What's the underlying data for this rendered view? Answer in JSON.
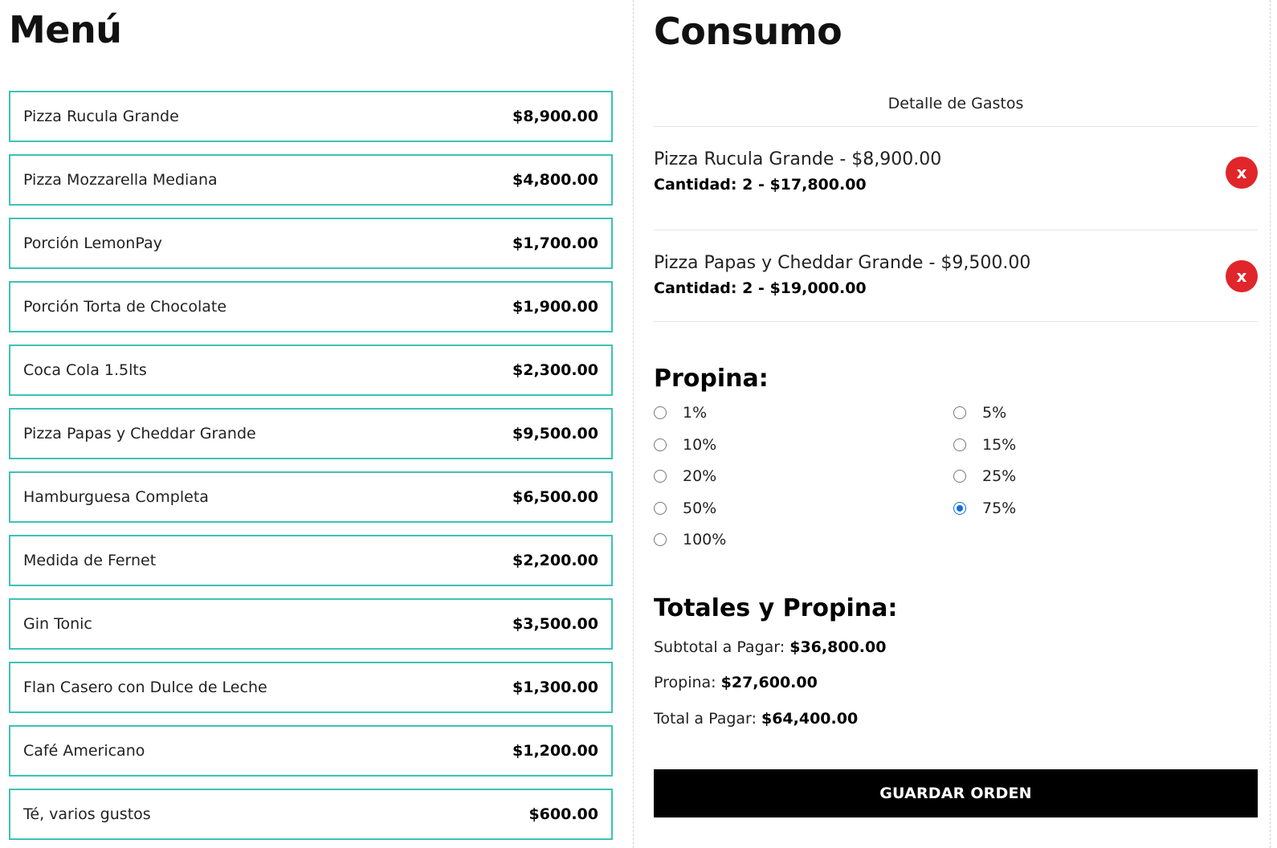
{
  "menu": {
    "title": "Menú",
    "items": [
      {
        "name": "Pizza Rucula Grande",
        "price": "$8,900.00"
      },
      {
        "name": "Pizza Mozzarella Mediana",
        "price": "$4,800.00"
      },
      {
        "name": "Porción LemonPay",
        "price": "$1,700.00"
      },
      {
        "name": "Porción Torta de Chocolate",
        "price": "$1,900.00"
      },
      {
        "name": "Coca Cola 1.5lts",
        "price": "$2,300.00"
      },
      {
        "name": "Pizza Papas y Cheddar Grande",
        "price": "$9,500.00"
      },
      {
        "name": "Hamburguesa Completa",
        "price": "$6,500.00"
      },
      {
        "name": "Medida de Fernet",
        "price": "$2,200.00"
      },
      {
        "name": "Gin Tonic",
        "price": "$3,500.00"
      },
      {
        "name": "Flan Casero con Dulce de Leche",
        "price": "$1,300.00"
      },
      {
        "name": "Café Americano",
        "price": "$1,200.00"
      },
      {
        "name": "Té, varios gustos",
        "price": "$600.00"
      }
    ]
  },
  "consumo": {
    "title": "Consumo",
    "detalle_header": "Detalle de Gastos",
    "orders": [
      {
        "title": "Pizza Rucula Grande - $8,900.00",
        "qty": "Cantidad: 2 - $17,800.00",
        "remove": "x"
      },
      {
        "title": "Pizza Papas y Cheddar Grande - $9,500.00",
        "qty": "Cantidad: 2 - $19,000.00",
        "remove": "x"
      }
    ]
  },
  "propina": {
    "title": "Propina:",
    "options": [
      "1%",
      "5%",
      "10%",
      "15%",
      "20%",
      "25%",
      "50%",
      "75%",
      "100%"
    ],
    "selected": "75%"
  },
  "totales": {
    "title": "Totales y Propina:",
    "subtotal_label": "Subtotal a Pagar:",
    "subtotal_value": "$36,800.00",
    "propina_label": "Propina:",
    "propina_value": "$27,600.00",
    "total_label": "Total a Pagar:",
    "total_value": "$64,400.00"
  },
  "save_button": "GUARDAR ORDEN",
  "colors": {
    "item_border": "#3fc1b6",
    "remove_button": "#e0262b",
    "radio_selected": "#0f6fde",
    "save_button_bg": "#000000"
  }
}
